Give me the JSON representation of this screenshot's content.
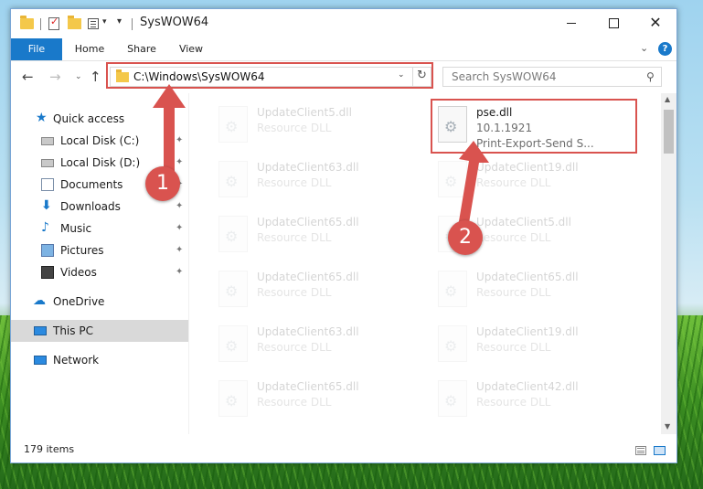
{
  "window": {
    "title": "SysWOW64",
    "customize_glyph": "▾",
    "dropdown_glyph": "▾"
  },
  "title_buttons": {
    "minimize": "",
    "maximize": "",
    "close": "✕"
  },
  "ribbon": {
    "tabs": [
      "File",
      "Home",
      "Share",
      "View"
    ],
    "expand_glyph": "⌄",
    "help_glyph": "?"
  },
  "nav": {
    "back": "←",
    "forward": "→",
    "recent": "⌄",
    "up": "↑",
    "address": "C:\\Windows\\SysWOW64",
    "address_dropdown": "⌄",
    "refresh": "↻",
    "search_placeholder": "Search SysWOW64",
    "search_glyph": "⚲"
  },
  "sidebar": {
    "items": [
      {
        "label": "Quick access",
        "icon": "star-icon",
        "pinned": false
      },
      {
        "label": "Local Disk (C:)",
        "icon": "drive-icon",
        "pinned": true
      },
      {
        "label": "Local Disk (D:)",
        "icon": "drive-icon",
        "pinned": true
      },
      {
        "label": "Documents",
        "icon": "documents-icon",
        "pinned": true
      },
      {
        "label": "Downloads",
        "icon": "downloads-icon",
        "pinned": true
      },
      {
        "label": "Music",
        "icon": "music-icon",
        "pinned": true
      },
      {
        "label": "Pictures",
        "icon": "pictures-icon",
        "pinned": true
      },
      {
        "label": "Videos",
        "icon": "videos-icon",
        "pinned": true
      },
      {
        "label": "OneDrive",
        "icon": "cloud-icon",
        "pinned": false
      },
      {
        "label": "This PC",
        "icon": "pc-icon",
        "pinned": false,
        "selected": true
      },
      {
        "label": "Network",
        "icon": "network-icon",
        "pinned": false
      }
    ],
    "pin_glyph": "📌"
  },
  "files": {
    "left_column": [
      {
        "name": "UpdateClient5.dll",
        "type": "Resource DLL"
      },
      {
        "name": "UpdateClient63.dll",
        "type": "Resource DLL"
      },
      {
        "name": "UpdateClient65.dll",
        "type": "Resource DLL"
      },
      {
        "name": "UpdateClient65.dll",
        "type": "Resource DLL"
      },
      {
        "name": "UpdateClient63.dll",
        "type": "Resource DLL"
      },
      {
        "name": "UpdateClient65.dll",
        "type": "Resource DLL"
      }
    ],
    "right_column": [
      {
        "name": "UpdateClient19.dll",
        "type": "Resource DLL"
      },
      {
        "name": "UpdateClient5.dll",
        "type": "Resource DLL"
      },
      {
        "name": "UpdateClient65.dll",
        "type": "Resource DLL"
      },
      {
        "name": "UpdateClient19.dll",
        "type": "Resource DLL"
      },
      {
        "name": "UpdateClient42.dll",
        "type": "Resource DLL"
      }
    ],
    "highlighted": {
      "name": "pse.dll",
      "version": "10.1.1921",
      "description": "Print-Export-Send S..."
    }
  },
  "status": {
    "item_count": "179 items"
  },
  "annotations": {
    "step1": "1",
    "step2": "2",
    "color": "#d9534f"
  }
}
